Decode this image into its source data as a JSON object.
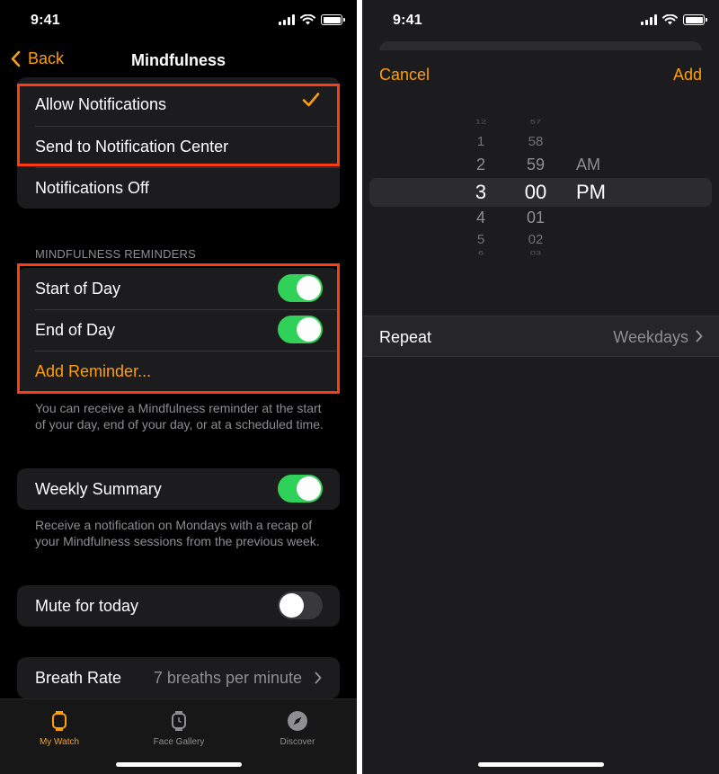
{
  "left": {
    "status_time": "9:41",
    "nav": {
      "back_label": "Back",
      "title": "Mindfulness"
    },
    "notifications": [
      "Allow Notifications",
      "Send to Notification Center",
      "Notifications Off"
    ],
    "reminders_header": "MINDFULNESS REMINDERS",
    "reminders": {
      "start_of_day": "Start of Day",
      "end_of_day": "End of Day",
      "add_reminder": "Add Reminder..."
    },
    "reminders_footer": "You can receive a Mindfulness reminder at the start of your day, end of your day, or at a scheduled time.",
    "weekly_summary": "Weekly Summary",
    "weekly_footer": "Receive a notification on Mondays with a recap of your Mindfulness sessions from the previous week.",
    "mute": "Mute for today",
    "breath_rate": {
      "label": "Breath Rate",
      "value": "7 breaths per minute"
    },
    "tabs": [
      "My Watch",
      "Face Gallery",
      "Discover"
    ],
    "toggles": {
      "start_of_day": true,
      "end_of_day": true,
      "weekly_summary": true,
      "mute": false
    }
  },
  "right": {
    "status_time": "9:41",
    "cancel_label": "Cancel",
    "add_label": "Add",
    "picker": {
      "hours": [
        "12",
        "1",
        "2",
        "3",
        "4",
        "5",
        "6"
      ],
      "minutes": [
        "57",
        "58",
        "59",
        "00",
        "01",
        "02",
        "03"
      ],
      "period": [
        "AM",
        "PM"
      ],
      "selected": {
        "hour": "3",
        "minute": "00",
        "period": "PM"
      }
    },
    "repeat": {
      "label": "Repeat",
      "value": "Weekdays"
    }
  },
  "colors": {
    "accent": "#ff9f0a",
    "toggle_on": "#30d158",
    "highlight": "#ff3b14"
  }
}
